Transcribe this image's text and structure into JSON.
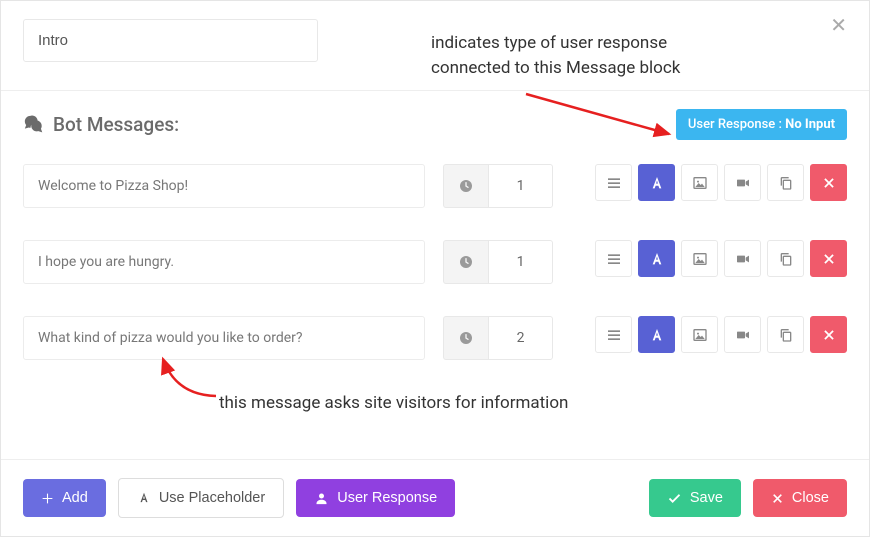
{
  "title_value": "Intro",
  "annotation1_line1": "indicates type of user response",
  "annotation1_line2": "connected to this Message block",
  "annotation2": "this message asks site visitors for information",
  "section_title": "Bot Messages:",
  "badge_prefix": "User Response : ",
  "badge_value": "No Input",
  "messages": [
    {
      "text": "Welcome to Pizza Shop!",
      "delay": "1"
    },
    {
      "text": "I hope you are hungry.",
      "delay": "1"
    },
    {
      "text": "What kind of pizza would you like to order?",
      "delay": "2"
    }
  ],
  "footer": {
    "add": "Add",
    "placeholder": "Use Placeholder",
    "user_response": "User Response",
    "save": "Save",
    "close": "Close"
  }
}
